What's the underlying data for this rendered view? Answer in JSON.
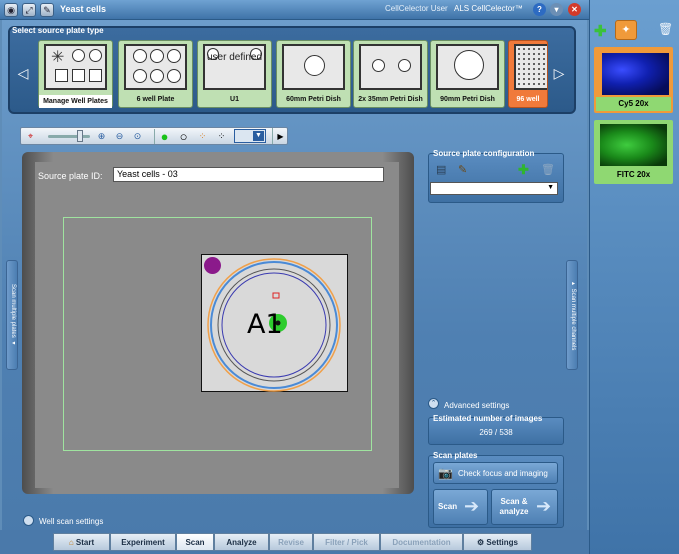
{
  "titlebar": {
    "title": "Yeast cells",
    "user": "CellCelector User",
    "product": "ALS CellCelector™"
  },
  "plate_section": {
    "title": "Select source plate type",
    "plates": [
      {
        "label": "Manage Well Plates"
      },
      {
        "label": "6 well Plate"
      },
      {
        "label": "U1",
        "thumb_text": "user defined"
      },
      {
        "label": "60mm Petri Dish"
      },
      {
        "label": "2x 35mm Petri Dish"
      },
      {
        "label": "90mm Petri Dish"
      },
      {
        "label": "96 well"
      }
    ]
  },
  "viewer": {
    "source_plate_id_label": "Source plate ID:",
    "source_plate_id_value": "Yeast cells - 03",
    "well_label": "A1",
    "left_tab": "Scan multiple plates",
    "right_tab": "Scan multiple channels"
  },
  "config": {
    "title": "Source plate configuration"
  },
  "advanced_settings": "Advanced settings",
  "estimated": {
    "title": "Estimated number of images",
    "value": "269 / 538"
  },
  "scan_plates": {
    "title": "Scan plates",
    "check_focus": "Check focus and imaging",
    "scan": "Scan",
    "scan_analyze": "Scan & analyze"
  },
  "well_scan_settings": "Well scan settings",
  "nav": {
    "start": "Start",
    "experiment": "Experiment",
    "scan": "Scan",
    "analyze": "Analyze",
    "revise": "Revise",
    "filter_pick": "Filter / Pick",
    "documentation": "Documentation",
    "settings": "Settings"
  },
  "channels": [
    {
      "label": "Cy5 20x",
      "color": "#1a2fd0"
    },
    {
      "label": "FITC 20x",
      "color": "#1aa01a"
    }
  ],
  "colors": {
    "accent": "#2c5a8a",
    "card_green": "#bfe0b3",
    "card_active": "#f07a3b",
    "channel_green": "#8fd872"
  }
}
